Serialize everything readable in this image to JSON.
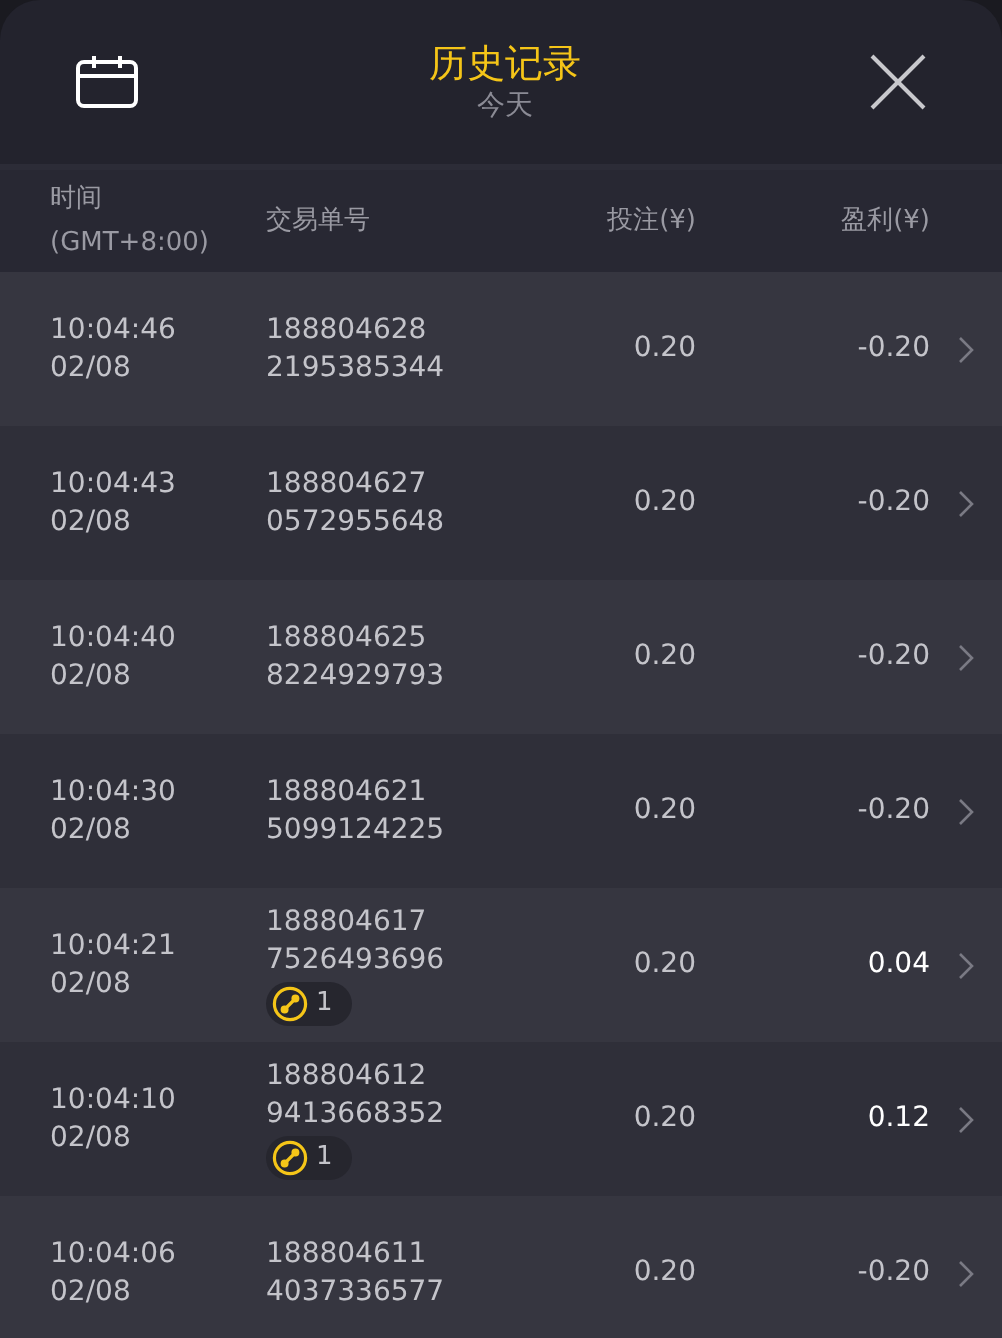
{
  "header": {
    "title": "历史记录",
    "subtitle": "今天"
  },
  "columns": [
    {
      "label": "时间",
      "sublabel": "(GMT+8:00)"
    },
    {
      "label": "交易单号"
    },
    {
      "label": "投注(¥)"
    },
    {
      "label": "盈利(¥)"
    }
  ],
  "rows": [
    {
      "time": "10:04:46",
      "date": "02/08",
      "order": [
        "188804628",
        "2195385344"
      ],
      "bet": "0.20",
      "profit": "-0.20",
      "win": false
    },
    {
      "time": "10:04:43",
      "date": "02/08",
      "order": [
        "188804627",
        "0572955648"
      ],
      "bet": "0.20",
      "profit": "-0.20",
      "win": false
    },
    {
      "time": "10:04:40",
      "date": "02/08",
      "order": [
        "188804625",
        "8224929793"
      ],
      "bet": "0.20",
      "profit": "-0.20",
      "win": false
    },
    {
      "time": "10:04:30",
      "date": "02/08",
      "order": [
        "188804621",
        "5099124225"
      ],
      "bet": "0.20",
      "profit": "-0.20",
      "win": false
    },
    {
      "time": "10:04:21",
      "date": "02/08",
      "order": [
        "188804617",
        "7526493696"
      ],
      "badge": "1",
      "bet": "0.20",
      "profit": "0.04",
      "win": true
    },
    {
      "time": "10:04:10",
      "date": "02/08",
      "order": [
        "188804612",
        "9413668352"
      ],
      "badge": "1",
      "bet": "0.20",
      "profit": "0.12",
      "win": true
    },
    {
      "time": "10:04:06",
      "date": "02/08",
      "order": [
        "188804611",
        "4037336577"
      ],
      "bet": "0.20",
      "profit": "-0.20",
      "win": false
    }
  ]
}
